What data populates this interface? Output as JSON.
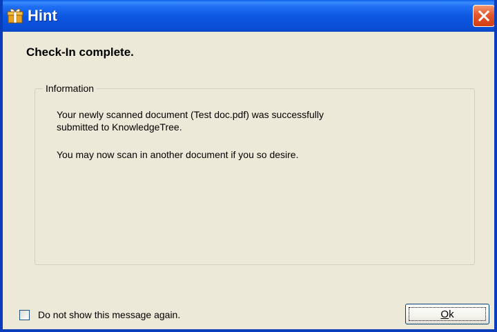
{
  "window": {
    "title": "Hint",
    "icon": "gift-box-icon"
  },
  "message": {
    "heading": "Check-In complete."
  },
  "information": {
    "legend": "Information",
    "line1": "Your newly scanned document (Test doc.pdf) was successfully",
    "line2": "submitted to KnowledgeTree.",
    "line3": "You may now scan in another document if you so desire."
  },
  "footer": {
    "checkbox_label": "Do not show this message again.",
    "checkbox_checked": false,
    "ok_mnemonic": "O",
    "ok_rest": "k"
  },
  "colors": {
    "titlebar": "#0b55e0",
    "window_border": "#0a3dba",
    "dialog_background": "#ece9d8",
    "close_button": "#d43d12"
  }
}
